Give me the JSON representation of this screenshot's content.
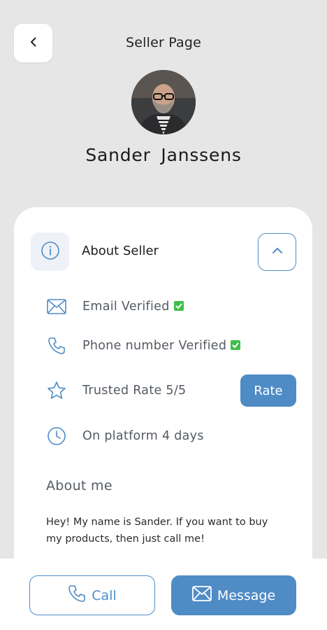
{
  "header": {
    "title": "Seller Page",
    "back_icon": "chevron-left-icon"
  },
  "seller": {
    "name": "Sander  Janssens",
    "avatar": "seller-avatar-photo"
  },
  "about_section": {
    "title": "About Seller",
    "icon": "info-icon",
    "toggle_icon": "chevron-up-icon",
    "items": [
      {
        "icon": "mail-icon",
        "label": "Email Verified",
        "verified": true
      },
      {
        "icon": "phone-icon",
        "label": "Phone number Verified",
        "verified": true
      },
      {
        "icon": "star-icon",
        "label": "Trusted Rate 5/5",
        "verified": false
      },
      {
        "icon": "clock-icon",
        "label": "On platform 4 days",
        "verified": false
      }
    ],
    "rate_label": "Rate"
  },
  "about_me": {
    "title": "About me",
    "text": "Hey! My name is Sander. If you want to buy my products, then just call me!"
  },
  "actions": {
    "call_label": "Call",
    "message_label": "Message"
  },
  "colors": {
    "accent": "#4f8cc6",
    "verified": "#3fbf4a",
    "background": "#e6e6e6"
  }
}
